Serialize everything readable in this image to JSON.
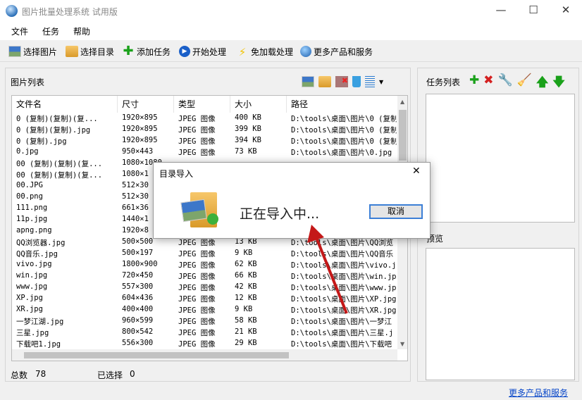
{
  "window": {
    "title": "图片批量处理系统 试用版",
    "min": "—",
    "max": "☐",
    "close": "✕"
  },
  "menu": [
    "文件",
    "任务",
    "帮助"
  ],
  "toolbar": [
    "选择图片",
    "选择目录",
    "添加任务",
    "开始处理",
    "免加载处理",
    "更多产品和服务"
  ],
  "left": {
    "title": "图片列表",
    "columns": [
      "文件名",
      "尺寸",
      "类型",
      "大小",
      "路径"
    ],
    "rows": [
      [
        "0 (复制)(复制)(复...",
        "1920×895",
        "JPEG 图像",
        "400 KB",
        "D:\\tools\\桌面\\图片\\0 (复制"
      ],
      [
        "0 (复制)(复制).jpg",
        "1920×895",
        "JPEG 图像",
        "399 KB",
        "D:\\tools\\桌面\\图片\\0 (复制"
      ],
      [
        "0 (复制).jpg",
        "1920×895",
        "JPEG 图像",
        "394 KB",
        "D:\\tools\\桌面\\图片\\0 (复制"
      ],
      [
        "0.jpg",
        "950×443",
        "JPEG 图像",
        "73 KB",
        "D:\\tools\\桌面\\图片\\0.jpg"
      ],
      [
        "00 (复制)(复制)(复...",
        "1080×1080",
        "",
        "",
        ""
      ],
      [
        "00 (复制)(复制)(复...",
        "1080×1",
        "",
        "",
        ""
      ],
      [
        "00.JPG",
        "512×30",
        "",
        "",
        ""
      ],
      [
        "00.png",
        "512×30",
        "",
        "",
        ""
      ],
      [
        "111.png",
        "661×36",
        "",
        "",
        ""
      ],
      [
        "11p.jpg",
        "1440×1",
        "",
        "",
        ""
      ],
      [
        "apng.png",
        "1920×8",
        "",
        "",
        ""
      ],
      [
        "QQ浏览器.jpg",
        "500×500",
        "JPEG 图像",
        "13 KB",
        "D:\\tools\\桌面\\图片\\QQ浏览"
      ],
      [
        "QQ音乐.jpg",
        "500×197",
        "JPEG 图像",
        "9 KB",
        "D:\\tools\\桌面\\图片\\QQ音乐"
      ],
      [
        "vivo.jpg",
        "1800×900",
        "JPEG 图像",
        "62 KB",
        "D:\\tools\\桌面\\图片\\vivo.j"
      ],
      [
        "win.jpg",
        "720×450",
        "JPEG 图像",
        "66 KB",
        "D:\\tools\\桌面\\图片\\win.jp"
      ],
      [
        "www.jpg",
        "557×300",
        "JPEG 图像",
        "42 KB",
        "D:\\tools\\桌面\\图片\\www.jp"
      ],
      [
        "XP.jpg",
        "604×436",
        "JPEG 图像",
        "12 KB",
        "D:\\tools\\桌面\\图片\\XP.jpg"
      ],
      [
        "XR.jpg",
        "400×400",
        "JPEG 图像",
        "9 KB",
        "D:\\tools\\桌面\\图片\\XR.jpg"
      ],
      [
        "一梦江湖.jpg",
        "960×599",
        "JPEG 图像",
        "58 KB",
        "D:\\tools\\桌面\\图片\\一梦江"
      ],
      [
        "三星.jpg",
        "800×542",
        "JPEG 图像",
        "21 KB",
        "D:\\tools\\桌面\\图片\\三星.j"
      ],
      [
        "下载吧1.jpg",
        "556×300",
        "JPEG 图像",
        "29 KB",
        "D:\\tools\\桌面\\图片\\下载吧"
      ]
    ],
    "total_label": "总数",
    "total": "78",
    "selected_label": "已选择",
    "selected": "0"
  },
  "right": {
    "tasks_title": "任务列表",
    "preview_title": "预览",
    "link": "更多产品和服务"
  },
  "dialog": {
    "title": "目录导入",
    "message": "正在导入中...",
    "cancel": "取消",
    "close": "✕"
  }
}
